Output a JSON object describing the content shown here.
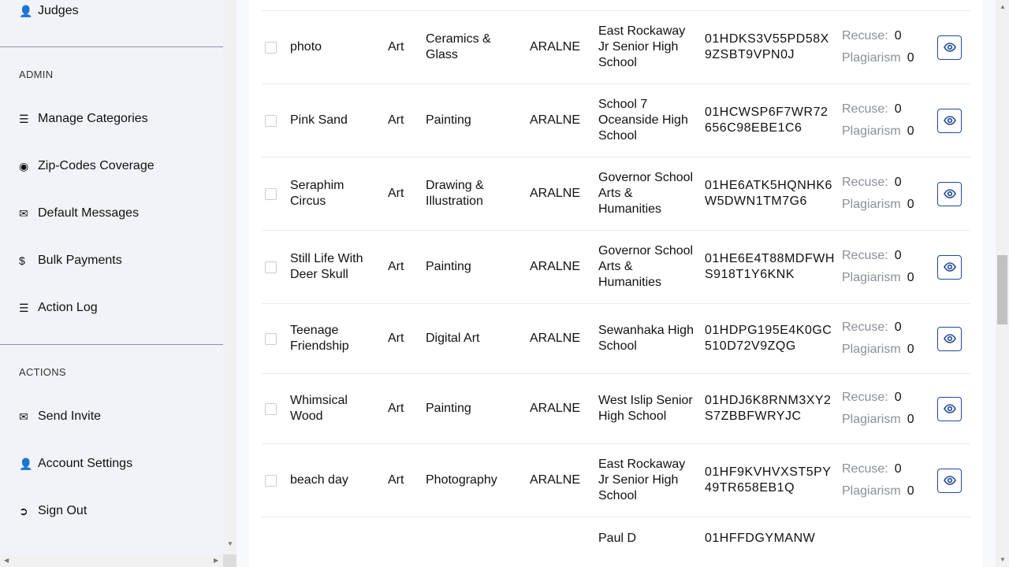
{
  "sidebar": {
    "top_item": {
      "label": "Judges",
      "icon": "user-icon"
    },
    "admin_heading": "ADMIN",
    "admin_items": [
      {
        "label": "Manage Categories",
        "icon": "list-icon"
      },
      {
        "label": "Zip-Codes Coverage",
        "icon": "map-pin-user-icon"
      },
      {
        "label": "Default Messages",
        "icon": "envelope-icon"
      },
      {
        "label": "Bulk Payments",
        "icon": "dollar-icon"
      },
      {
        "label": "Action Log",
        "icon": "list-icon"
      }
    ],
    "actions_heading": "ACTIONS",
    "action_items": [
      {
        "label": "Send Invite",
        "icon": "envelope-icon"
      },
      {
        "label": "Account Settings",
        "icon": "user-icon"
      },
      {
        "label": "Sign Out",
        "icon": "sign-out-icon"
      }
    ]
  },
  "table": {
    "recuse_label": "Recuse:",
    "plagiarism_label": "Plagiarism",
    "rows": [
      {
        "title": "photo",
        "division": "Art",
        "category": "Ceramics & Glass",
        "code": "ARALNE",
        "school": "East Rockaway Jr Senior High School",
        "id": "01HDKS3V55PD58X9ZSBT9VPN0J",
        "recuse": "0",
        "plagiarism": "0"
      },
      {
        "title": "Pink Sand",
        "division": "Art",
        "category": "Painting",
        "code": "ARALNE",
        "school": "School 7 Oceanside High School",
        "id": "01HCWSP6F7WR72656C98EBE1C6",
        "recuse": "0",
        "plagiarism": "0"
      },
      {
        "title": "Seraphim Circus",
        "division": "Art",
        "category": "Drawing & Illustration",
        "code": "ARALNE",
        "school": "Governor School Arts & Humanities",
        "id": "01HE6ATK5HQNHK6W5DWN1TM7G6",
        "recuse": "0",
        "plagiarism": "0"
      },
      {
        "title": "Still Life With Deer Skull",
        "division": "Art",
        "category": "Painting",
        "code": "ARALNE",
        "school": "Governor School Arts & Humanities",
        "id": "01HE6E4T88MDFWHS918T1Y6KNK",
        "recuse": "0",
        "plagiarism": "0"
      },
      {
        "title": "Teenage Friendship",
        "division": "Art",
        "category": "Digital Art",
        "code": "ARALNE",
        "school": "Sewanhaka High School",
        "id": "01HDPG195E4K0GC510D72V9ZQG",
        "recuse": "0",
        "plagiarism": "0"
      },
      {
        "title": "Whimsical Wood",
        "division": "Art",
        "category": "Painting",
        "code": "ARALNE",
        "school": "West Islip Senior High School",
        "id": "01HDJ6K8RNM3XY2S7ZBBFWRYJC",
        "recuse": "0",
        "plagiarism": "0"
      },
      {
        "title": "beach day",
        "division": "Art",
        "category": "Photography",
        "code": "ARALNE",
        "school": "East Rockaway Jr Senior High School",
        "id": "01HF9KVHVXST5PY49TR658EB1Q",
        "recuse": "0",
        "plagiarism": "0"
      },
      {
        "title": "",
        "division": "",
        "category": "",
        "code": "",
        "school": "Paul D",
        "id": "01HFFDGYMANW",
        "recuse": "",
        "plagiarism": ""
      }
    ]
  }
}
